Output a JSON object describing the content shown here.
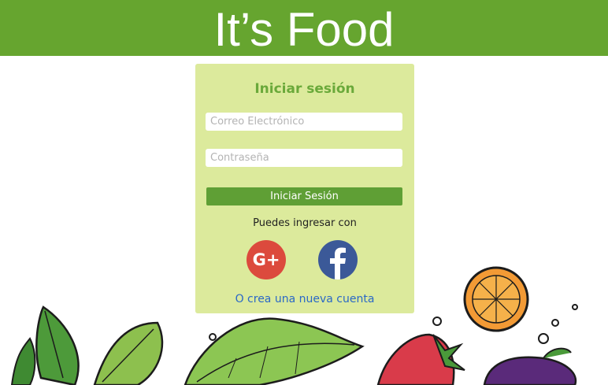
{
  "header": {
    "title": "It’s Food"
  },
  "login": {
    "title": "Iniciar sesión",
    "email_placeholder": "Correo Electrónico",
    "password_placeholder": "Contraseña",
    "submit_label": "Iniciar Sesión",
    "alt_text": "Puedes ingresar con",
    "social": [
      {
        "name": "google-plus-icon",
        "glyph": "G+"
      },
      {
        "name": "facebook-icon",
        "glyph": "f"
      }
    ],
    "create_account": "O crea una nueva cuenta"
  },
  "colors": {
    "header": "#66a52f",
    "card": "#dcea9c",
    "button": "#5f9f35",
    "title": "#6aa93a",
    "link": "#2a68c7",
    "google": "#dc4a3d",
    "facebook": "#3b5998"
  }
}
